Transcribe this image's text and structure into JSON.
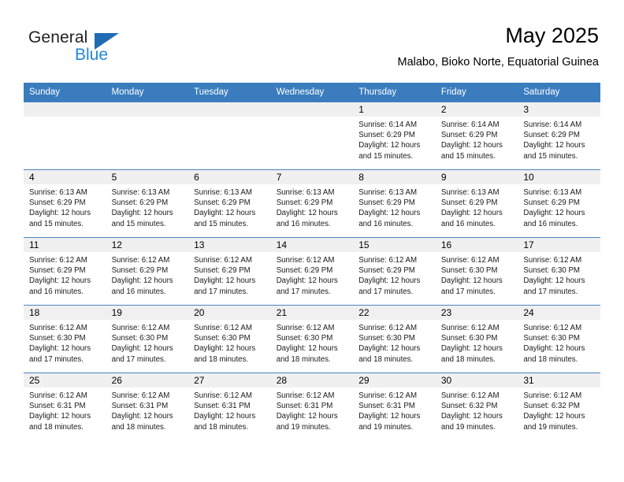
{
  "brand": {
    "name_part1": "General",
    "name_part2": "Blue",
    "triangle_color": "#1f6cb4",
    "blue_color": "#1f87d6"
  },
  "header": {
    "month_title": "May 2025",
    "location": "Malabo, Bioko Norte, Equatorial Guinea"
  },
  "theme": {
    "header_bg": "#3a7cbe",
    "daynum_bg": "#f0f0f0",
    "row_divider": "#4a86c2"
  },
  "calendar": {
    "weekday_headers": [
      "Sunday",
      "Monday",
      "Tuesday",
      "Wednesday",
      "Thursday",
      "Friday",
      "Saturday"
    ],
    "weeks": [
      [
        {
          "day": "",
          "sunrise": "",
          "sunset": "",
          "daylight_line1": "",
          "daylight_line2": "",
          "empty": true
        },
        {
          "day": "",
          "sunrise": "",
          "sunset": "",
          "daylight_line1": "",
          "daylight_line2": "",
          "empty": true
        },
        {
          "day": "",
          "sunrise": "",
          "sunset": "",
          "daylight_line1": "",
          "daylight_line2": "",
          "empty": true
        },
        {
          "day": "",
          "sunrise": "",
          "sunset": "",
          "daylight_line1": "",
          "daylight_line2": "",
          "empty": true
        },
        {
          "day": "1",
          "sunrise": "Sunrise: 6:14 AM",
          "sunset": "Sunset: 6:29 PM",
          "daylight_line1": "Daylight: 12 hours",
          "daylight_line2": "and 15 minutes."
        },
        {
          "day": "2",
          "sunrise": "Sunrise: 6:14 AM",
          "sunset": "Sunset: 6:29 PM",
          "daylight_line1": "Daylight: 12 hours",
          "daylight_line2": "and 15 minutes."
        },
        {
          "day": "3",
          "sunrise": "Sunrise: 6:14 AM",
          "sunset": "Sunset: 6:29 PM",
          "daylight_line1": "Daylight: 12 hours",
          "daylight_line2": "and 15 minutes."
        }
      ],
      [
        {
          "day": "4",
          "sunrise": "Sunrise: 6:13 AM",
          "sunset": "Sunset: 6:29 PM",
          "daylight_line1": "Daylight: 12 hours",
          "daylight_line2": "and 15 minutes."
        },
        {
          "day": "5",
          "sunrise": "Sunrise: 6:13 AM",
          "sunset": "Sunset: 6:29 PM",
          "daylight_line1": "Daylight: 12 hours",
          "daylight_line2": "and 15 minutes."
        },
        {
          "day": "6",
          "sunrise": "Sunrise: 6:13 AM",
          "sunset": "Sunset: 6:29 PM",
          "daylight_line1": "Daylight: 12 hours",
          "daylight_line2": "and 15 minutes."
        },
        {
          "day": "7",
          "sunrise": "Sunrise: 6:13 AM",
          "sunset": "Sunset: 6:29 PM",
          "daylight_line1": "Daylight: 12 hours",
          "daylight_line2": "and 16 minutes."
        },
        {
          "day": "8",
          "sunrise": "Sunrise: 6:13 AM",
          "sunset": "Sunset: 6:29 PM",
          "daylight_line1": "Daylight: 12 hours",
          "daylight_line2": "and 16 minutes."
        },
        {
          "day": "9",
          "sunrise": "Sunrise: 6:13 AM",
          "sunset": "Sunset: 6:29 PM",
          "daylight_line1": "Daylight: 12 hours",
          "daylight_line2": "and 16 minutes."
        },
        {
          "day": "10",
          "sunrise": "Sunrise: 6:13 AM",
          "sunset": "Sunset: 6:29 PM",
          "daylight_line1": "Daylight: 12 hours",
          "daylight_line2": "and 16 minutes."
        }
      ],
      [
        {
          "day": "11",
          "sunrise": "Sunrise: 6:12 AM",
          "sunset": "Sunset: 6:29 PM",
          "daylight_line1": "Daylight: 12 hours",
          "daylight_line2": "and 16 minutes."
        },
        {
          "day": "12",
          "sunrise": "Sunrise: 6:12 AM",
          "sunset": "Sunset: 6:29 PM",
          "daylight_line1": "Daylight: 12 hours",
          "daylight_line2": "and 16 minutes."
        },
        {
          "day": "13",
          "sunrise": "Sunrise: 6:12 AM",
          "sunset": "Sunset: 6:29 PM",
          "daylight_line1": "Daylight: 12 hours",
          "daylight_line2": "and 17 minutes."
        },
        {
          "day": "14",
          "sunrise": "Sunrise: 6:12 AM",
          "sunset": "Sunset: 6:29 PM",
          "daylight_line1": "Daylight: 12 hours",
          "daylight_line2": "and 17 minutes."
        },
        {
          "day": "15",
          "sunrise": "Sunrise: 6:12 AM",
          "sunset": "Sunset: 6:29 PM",
          "daylight_line1": "Daylight: 12 hours",
          "daylight_line2": "and 17 minutes."
        },
        {
          "day": "16",
          "sunrise": "Sunrise: 6:12 AM",
          "sunset": "Sunset: 6:30 PM",
          "daylight_line1": "Daylight: 12 hours",
          "daylight_line2": "and 17 minutes."
        },
        {
          "day": "17",
          "sunrise": "Sunrise: 6:12 AM",
          "sunset": "Sunset: 6:30 PM",
          "daylight_line1": "Daylight: 12 hours",
          "daylight_line2": "and 17 minutes."
        }
      ],
      [
        {
          "day": "18",
          "sunrise": "Sunrise: 6:12 AM",
          "sunset": "Sunset: 6:30 PM",
          "daylight_line1": "Daylight: 12 hours",
          "daylight_line2": "and 17 minutes."
        },
        {
          "day": "19",
          "sunrise": "Sunrise: 6:12 AM",
          "sunset": "Sunset: 6:30 PM",
          "daylight_line1": "Daylight: 12 hours",
          "daylight_line2": "and 17 minutes."
        },
        {
          "day": "20",
          "sunrise": "Sunrise: 6:12 AM",
          "sunset": "Sunset: 6:30 PM",
          "daylight_line1": "Daylight: 12 hours",
          "daylight_line2": "and 18 minutes."
        },
        {
          "day": "21",
          "sunrise": "Sunrise: 6:12 AM",
          "sunset": "Sunset: 6:30 PM",
          "daylight_line1": "Daylight: 12 hours",
          "daylight_line2": "and 18 minutes."
        },
        {
          "day": "22",
          "sunrise": "Sunrise: 6:12 AM",
          "sunset": "Sunset: 6:30 PM",
          "daylight_line1": "Daylight: 12 hours",
          "daylight_line2": "and 18 minutes."
        },
        {
          "day": "23",
          "sunrise": "Sunrise: 6:12 AM",
          "sunset": "Sunset: 6:30 PM",
          "daylight_line1": "Daylight: 12 hours",
          "daylight_line2": "and 18 minutes."
        },
        {
          "day": "24",
          "sunrise": "Sunrise: 6:12 AM",
          "sunset": "Sunset: 6:30 PM",
          "daylight_line1": "Daylight: 12 hours",
          "daylight_line2": "and 18 minutes."
        }
      ],
      [
        {
          "day": "25",
          "sunrise": "Sunrise: 6:12 AM",
          "sunset": "Sunset: 6:31 PM",
          "daylight_line1": "Daylight: 12 hours",
          "daylight_line2": "and 18 minutes."
        },
        {
          "day": "26",
          "sunrise": "Sunrise: 6:12 AM",
          "sunset": "Sunset: 6:31 PM",
          "daylight_line1": "Daylight: 12 hours",
          "daylight_line2": "and 18 minutes."
        },
        {
          "day": "27",
          "sunrise": "Sunrise: 6:12 AM",
          "sunset": "Sunset: 6:31 PM",
          "daylight_line1": "Daylight: 12 hours",
          "daylight_line2": "and 18 minutes."
        },
        {
          "day": "28",
          "sunrise": "Sunrise: 6:12 AM",
          "sunset": "Sunset: 6:31 PM",
          "daylight_line1": "Daylight: 12 hours",
          "daylight_line2": "and 19 minutes."
        },
        {
          "day": "29",
          "sunrise": "Sunrise: 6:12 AM",
          "sunset": "Sunset: 6:31 PM",
          "daylight_line1": "Daylight: 12 hours",
          "daylight_line2": "and 19 minutes."
        },
        {
          "day": "30",
          "sunrise": "Sunrise: 6:12 AM",
          "sunset": "Sunset: 6:32 PM",
          "daylight_line1": "Daylight: 12 hours",
          "daylight_line2": "and 19 minutes."
        },
        {
          "day": "31",
          "sunrise": "Sunrise: 6:12 AM",
          "sunset": "Sunset: 6:32 PM",
          "daylight_line1": "Daylight: 12 hours",
          "daylight_line2": "and 19 minutes."
        }
      ]
    ]
  }
}
